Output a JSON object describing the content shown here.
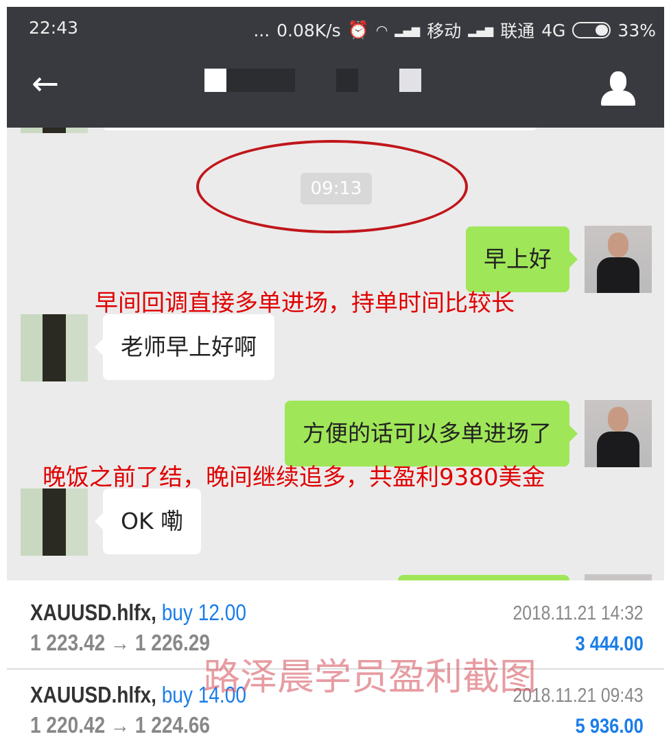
{
  "status_bar": {
    "time": "22:43",
    "dots": "...",
    "net_speed": "0.08K/s",
    "carrier1": "移动",
    "carrier2": "联通",
    "network": "4G",
    "battery": "33%"
  },
  "header": {
    "back_icon": "arrow-left-icon",
    "profile_icon": "person-icon"
  },
  "chat": {
    "timestamp": "09:13",
    "messages": [
      {
        "side": "me",
        "text": "早上好"
      },
      {
        "side": "other",
        "text": "老师早上好啊"
      },
      {
        "side": "me",
        "text": "方便的话可以多单进场了"
      },
      {
        "side": "other",
        "text": "OK 嘞"
      }
    ],
    "annotations": [
      "早间回调直接多单进场，持单时间比较长",
      "晚饭之前了结，晚间继续追多，共盈利9380美金"
    ],
    "highlight_color": "#c0161b"
  },
  "trades": [
    {
      "symbol": "XAUUSD.hlfx,",
      "side": "buy 12.00",
      "price": "1 223.42 → 1 226.29",
      "datetime": "2018.11.21 14:32",
      "profit": "3 444.00"
    },
    {
      "symbol": "XAUUSD.hlfx,",
      "side": "buy 14.00",
      "price": "1 220.42 → 1 224.66",
      "datetime": "2018.11.21 09:43",
      "profit": "5 936.00"
    }
  ],
  "watermark": "路泽晨学员盈利截图",
  "colors": {
    "bar": "#393a3f",
    "my_bubble": "#9fe658",
    "profit": "#1a7de8",
    "annotation": "#e00000"
  }
}
